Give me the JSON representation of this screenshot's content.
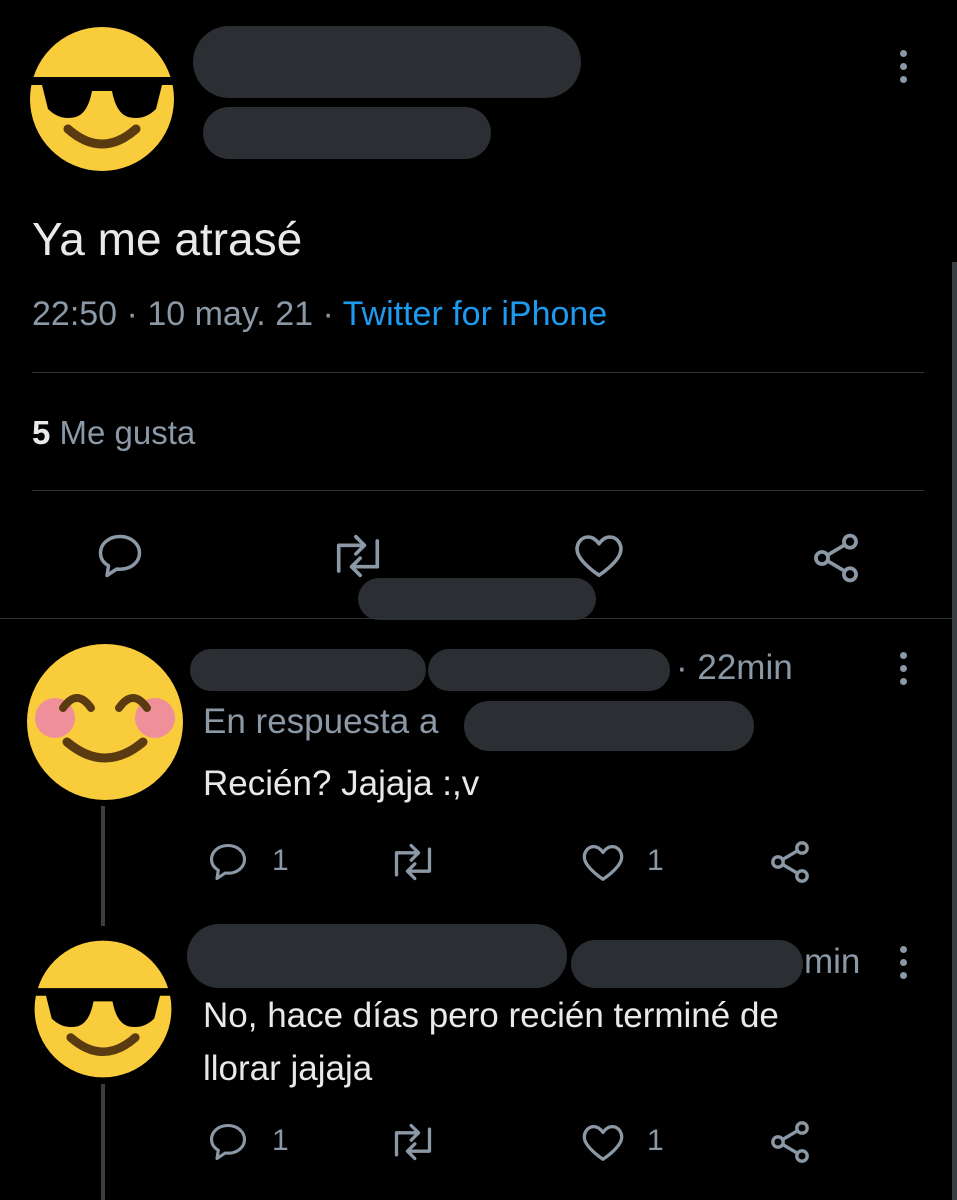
{
  "main_tweet": {
    "text": "Ya me atrasé",
    "time": "22:50",
    "sep1": "·",
    "date": "10 may. 21",
    "sep2": "·",
    "source": "Twitter for iPhone",
    "likes_count": "5",
    "likes_label": "Me gusta"
  },
  "replies": [
    {
      "time_suffix": "· 22min",
      "reply_to_label": "En respuesta a",
      "text": "Recién? Jajaja :,v",
      "reply_count": "1",
      "like_count": "1"
    },
    {
      "time_suffix": "min",
      "text_line1": "No, hace días pero recién terminé de",
      "text_line2": "llorar jajaja",
      "reply_count": "1",
      "like_count": "1"
    }
  ],
  "colors": {
    "background": "#000000",
    "text": "#e7e9ea",
    "muted": "#8b98a5",
    "link": "#1d9bf0",
    "redaction": "#2b2e33",
    "emoji_face": "#f9cc3c"
  }
}
